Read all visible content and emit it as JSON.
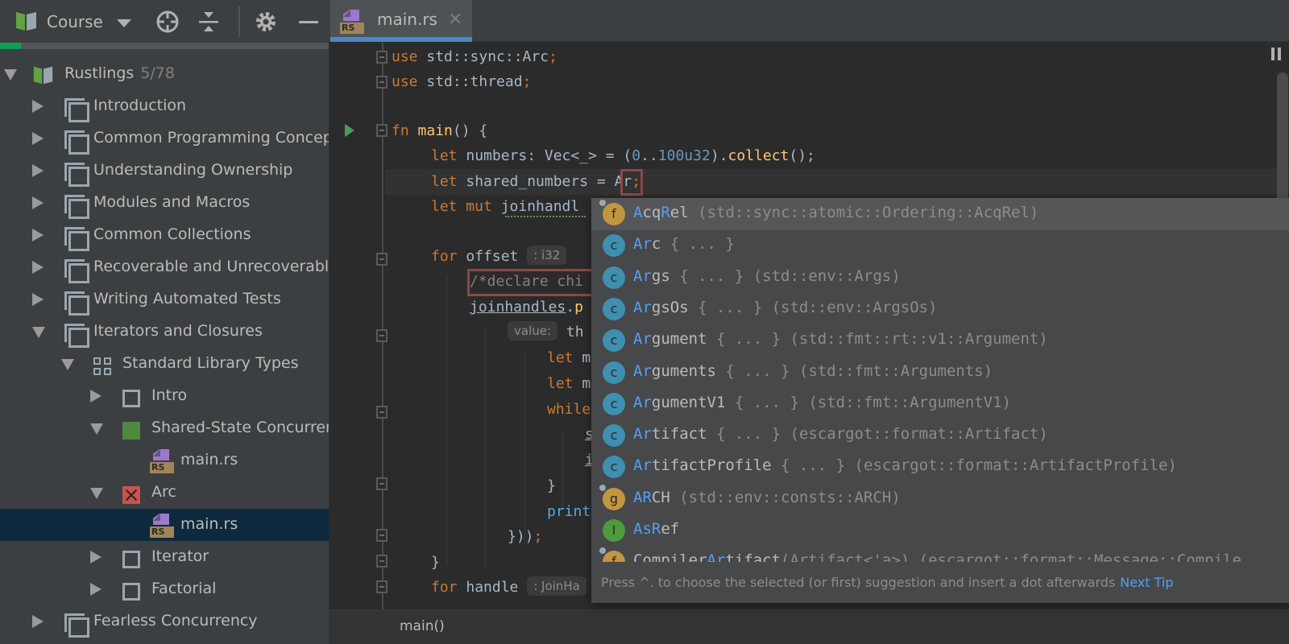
{
  "sidebar": {
    "toolbar": {
      "course_label": "Course",
      "icons": [
        "course-book-icon",
        "chevron-down-icon",
        "locate-icon",
        "collapse-all-icon",
        "gear-icon",
        "minimize-icon"
      ]
    },
    "progress": {
      "fraction": 0.064,
      "color": "#0f9d58"
    },
    "tree": {
      "root": {
        "label": "Rustlings",
        "count": "5/78"
      },
      "lessons": [
        {
          "label": "Introduction",
          "expanded": false
        },
        {
          "label": "Common Programming Concepts",
          "expanded": false
        },
        {
          "label": "Understanding Ownership",
          "expanded": false
        },
        {
          "label": "Modules and Macros",
          "expanded": false
        },
        {
          "label": "Common Collections",
          "expanded": false
        },
        {
          "label": "Recoverable and Unrecoverable Errors",
          "expanded": false
        },
        {
          "label": "Writing Automated Tests",
          "expanded": false
        },
        {
          "label": "Iterators and Closures",
          "expanded": true
        }
      ],
      "section": {
        "label": "Standard Library Types"
      },
      "tasks": [
        {
          "label": "Intro",
          "status": "unchecked"
        },
        {
          "label": "Shared-State Concurrency",
          "status": "solved",
          "file": "main.rs"
        },
        {
          "label": "Arc",
          "status": "failed",
          "file": "main.rs"
        },
        {
          "label": "Iterator",
          "status": "unchecked"
        },
        {
          "label": "Factorial",
          "status": "unchecked"
        }
      ],
      "last_lesson": {
        "label": "Fearless Concurrency"
      }
    }
  },
  "editor": {
    "tab": {
      "label": "main.rs",
      "badge": "RS"
    },
    "breadcrumb": "main()",
    "hints": {
      "offset_type": ": i32",
      "value_param": "value:",
      "handle_type": ": JoinHa"
    },
    "lines": {
      "l1": [
        "use",
        " std::sync::Arc",
        ";"
      ],
      "l2": [
        "use",
        " std::thread",
        ";"
      ],
      "l4": [
        "fn",
        " ",
        "main",
        "() {"
      ],
      "l5": [
        "let",
        " numbers: Vec<_> = (",
        "0",
        "..",
        "100u32",
        ").",
        "collect",
        "();"
      ],
      "l6": [
        "let",
        " shared_numbers = ",
        "Ar",
        ";"
      ],
      "l7": [
        "let mut",
        " ",
        "joinhandl"
      ],
      "l9": [
        "for",
        " offset"
      ],
      "l10": "/*declare chi",
      "l11": [
        "joinhandles",
        ".",
        "p"
      ],
      "l12": "th",
      "l13": [
        "let",
        " m"
      ],
      "l14": [
        "let",
        " m"
      ],
      "l15": "while",
      "l16": "s",
      "l17": "i",
      "l18": "}",
      "l19": "print",
      "l20": [
        "}))",
        ";"
      ],
      "l21": "}",
      "l22": [
        "for",
        " handle"
      ]
    }
  },
  "completion": {
    "items": [
      {
        "kind": "f",
        "icon": "function-icon",
        "match": [
          "A",
          "cq",
          "R",
          "el"
        ],
        "tail": " (std::sync::atomic::Ordering::AcqRel)",
        "selected": true
      },
      {
        "kind": "c",
        "icon": "class-icon",
        "match": [
          "Ar",
          "c",
          "",
          ""
        ],
        "tail": " { ... }"
      },
      {
        "kind": "c",
        "icon": "class-icon",
        "match": [
          "Ar",
          "gs",
          "",
          ""
        ],
        "tail": " { ... } (std::env::Args)"
      },
      {
        "kind": "c",
        "icon": "class-icon",
        "match": [
          "Ar",
          "gsOs",
          "",
          ""
        ],
        "tail": " { ... } (std::env::ArgsOs)"
      },
      {
        "kind": "c",
        "icon": "class-icon",
        "match": [
          "Ar",
          "gument",
          "",
          ""
        ],
        "tail": " { ... } (std::fmt::rt::v1::Argument)"
      },
      {
        "kind": "c",
        "icon": "class-icon",
        "match": [
          "Ar",
          "guments",
          "",
          ""
        ],
        "tail": " { ... } (std::fmt::Arguments)"
      },
      {
        "kind": "c",
        "icon": "class-icon",
        "match": [
          "Ar",
          "gumentV1",
          "",
          ""
        ],
        "tail": " { ... } (std::fmt::ArgumentV1)"
      },
      {
        "kind": "c",
        "icon": "class-icon",
        "match": [
          "Ar",
          "tifact",
          "",
          ""
        ],
        "tail": " { ... } (escargot::format::Artifact)"
      },
      {
        "kind": "c",
        "icon": "class-icon",
        "match": [
          "Ar",
          "tifactProfile",
          "",
          ""
        ],
        "tail": " { ... } (escargot::format::ArtifactProfile)"
      },
      {
        "kind": "g",
        "icon": "constant-icon",
        "match": [
          "AR",
          "CH",
          "",
          ""
        ],
        "tail": " (std::env::consts::ARCH)"
      },
      {
        "kind": "I",
        "icon": "interface-icon",
        "match": [
          "As",
          "",
          "R",
          "ef"
        ],
        "tail": ""
      },
      {
        "kind": "f",
        "icon": "function-icon",
        "match": [
          "Compiler",
          "Ar",
          "tifact",
          ""
        ],
        "tail": "(Artifact<'a>) (escargot::format::Message::Compile"
      }
    ],
    "footer": {
      "text": "Press ^. to choose the selected (or first) suggestion and insert a dot afterwards",
      "link": "Next Tip"
    }
  }
}
